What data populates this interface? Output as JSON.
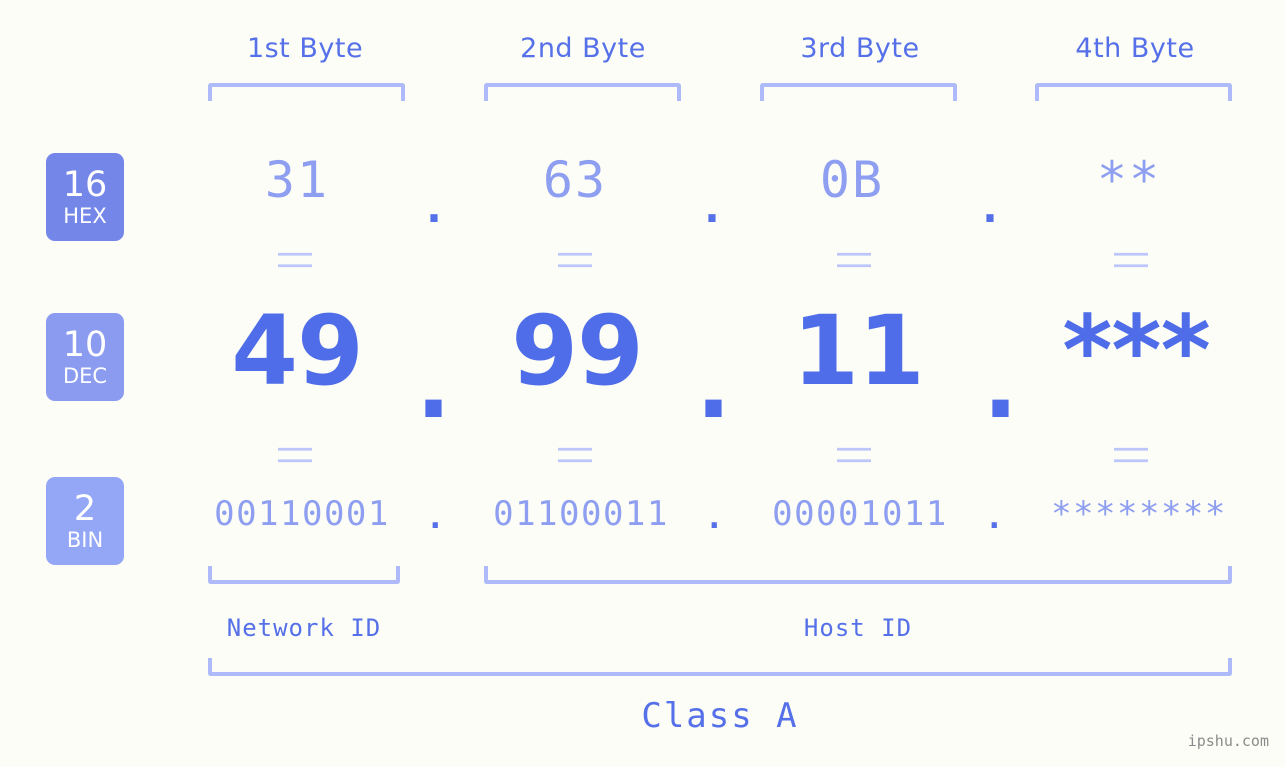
{
  "watermark": "ipshu.com",
  "byte_headers": [
    {
      "label": "1st Byte"
    },
    {
      "label": "2nd Byte"
    },
    {
      "label": "3rd Byte"
    },
    {
      "label": "4th Byte"
    }
  ],
  "radix_badges": [
    {
      "base": "16",
      "name": "HEX",
      "color": "#7486e8"
    },
    {
      "base": "10",
      "name": "DEC",
      "color": "#8b9cf0"
    },
    {
      "base": "2",
      "name": "BIN",
      "color": "#93a7f6"
    }
  ],
  "rows": {
    "hex": {
      "values": [
        "31",
        "63",
        "0B",
        "**"
      ],
      "separator": "."
    },
    "dec": {
      "values": [
        "49",
        "99",
        "11",
        "***"
      ],
      "separator": "."
    },
    "bin": {
      "values": [
        "00110001",
        "01100011",
        "00001011",
        "********"
      ],
      "separator": "."
    }
  },
  "connector": "||",
  "sections": {
    "network_id": "Network ID",
    "host_id": "Host ID",
    "class": "Class A"
  },
  "colors": {
    "background": "#fcfdf7",
    "primary": "#5570e8",
    "secondary": "#8e9ef0",
    "bracket": "#aebafa",
    "connector": "#bcc6fb",
    "watermark": "#8b8b8b"
  }
}
